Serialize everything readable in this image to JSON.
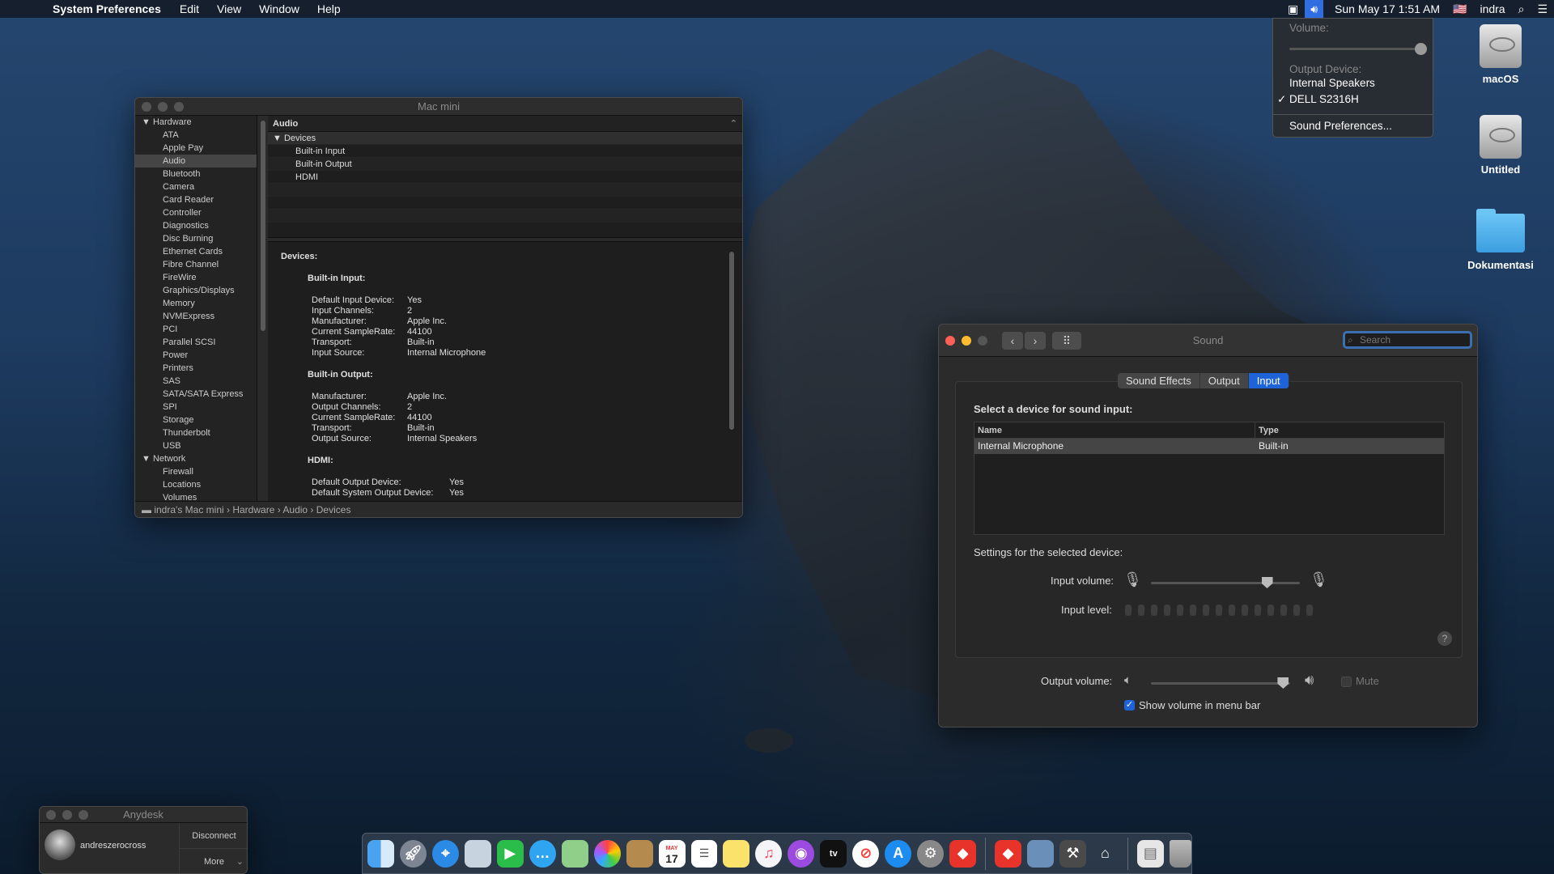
{
  "menubar": {
    "app": "System Preferences",
    "menus": [
      "Edit",
      "View",
      "Window",
      "Help"
    ],
    "datetime": "Sun May 17  1:51 AM",
    "user": "indra"
  },
  "volume_menu": {
    "volume_label": "Volume:",
    "volume_level": 0.95,
    "output_label": "Output Device:",
    "devices": [
      "Internal Speakers",
      "DELL S2316H"
    ],
    "checked": "✓",
    "prefs": "Sound Preferences..."
  },
  "desktop": {
    "icons": [
      "macOS",
      "Untitled",
      "Dokumentasi"
    ]
  },
  "sysinfo": {
    "title": "Mac mini",
    "sidebar": [
      "Hardware",
      "ATA",
      "Apple Pay",
      "Audio",
      "Bluetooth",
      "Camera",
      "Card Reader",
      "Controller",
      "Diagnostics",
      "Disc Burning",
      "Ethernet Cards",
      "Fibre Channel",
      "FireWire",
      "Graphics/Displays",
      "Memory",
      "NVMExpress",
      "PCI",
      "Parallel SCSI",
      "Power",
      "Printers",
      "SAS",
      "SATA/SATA Express",
      "SPI",
      "Storage",
      "Thunderbolt",
      "USB",
      "Network",
      "Firewall",
      "Locations",
      "Volumes"
    ],
    "pane_header": "Audio",
    "tree": {
      "group": "Devices",
      "items": [
        "Built-in Input",
        "Built-in Output",
        "HDMI"
      ]
    },
    "detail": {
      "heading": "Devices:",
      "input_heading": "Built-in Input:",
      "input": [
        [
          "Default Input Device:",
          "Yes"
        ],
        [
          "Input Channels:",
          "2"
        ],
        [
          "Manufacturer:",
          "Apple Inc."
        ],
        [
          "Current SampleRate:",
          "44100"
        ],
        [
          "Transport:",
          "Built-in"
        ],
        [
          "Input Source:",
          "Internal Microphone"
        ]
      ],
      "output_heading": "Built-in Output:",
      "output": [
        [
          "Manufacturer:",
          "Apple Inc."
        ],
        [
          "Output Channels:",
          "2"
        ],
        [
          "Current SampleRate:",
          "44100"
        ],
        [
          "Transport:",
          "Built-in"
        ],
        [
          "Output Source:",
          "Internal Speakers"
        ]
      ],
      "hdmi_heading": "HDMI:",
      "hdmi": [
        [
          "Default Output Device:",
          "Yes"
        ],
        [
          "Default System Output Device:",
          "Yes"
        ]
      ]
    },
    "path": [
      "indra's Mac mini",
      "Hardware",
      "Audio",
      "Devices"
    ]
  },
  "sound": {
    "title": "Sound",
    "search_placeholder": "Search",
    "tabs": [
      "Sound Effects",
      "Output",
      "Input"
    ],
    "select_label": "Select a device for sound input:",
    "columns": [
      "Name",
      "Type"
    ],
    "rows": [
      [
        "Internal Microphone",
        "Built-in"
      ]
    ],
    "settings_label": "Settings for the selected device:",
    "input_volume_label": "Input volume:",
    "input_volume": 0.78,
    "input_level_label": "Input level:",
    "output_volume_label": "Output volume:",
    "output_volume": 0.95,
    "mute_label": "Mute",
    "show_volume_label": "Show volume in menu bar",
    "show_volume": true,
    "help": "?"
  },
  "anydesk": {
    "title": "Anydesk",
    "user": "andreszerocross",
    "disconnect": "Disconnect",
    "more": "More"
  },
  "dock": {
    "apps": [
      "finder",
      "launchpad",
      "safari",
      "mail",
      "facetime",
      "messages",
      "maps",
      "photos",
      "notes",
      "calendar",
      "reminders",
      "stickies",
      "music",
      "podcasts",
      "tv",
      "news",
      "app-store",
      "system-preferences",
      "anydesk",
      "anydesk-2",
      "preview",
      "xcode",
      "installer",
      "downloads",
      "trash"
    ],
    "calendar_day": "17",
    "calendar_month": "MAY",
    "tv_label": "tv"
  }
}
